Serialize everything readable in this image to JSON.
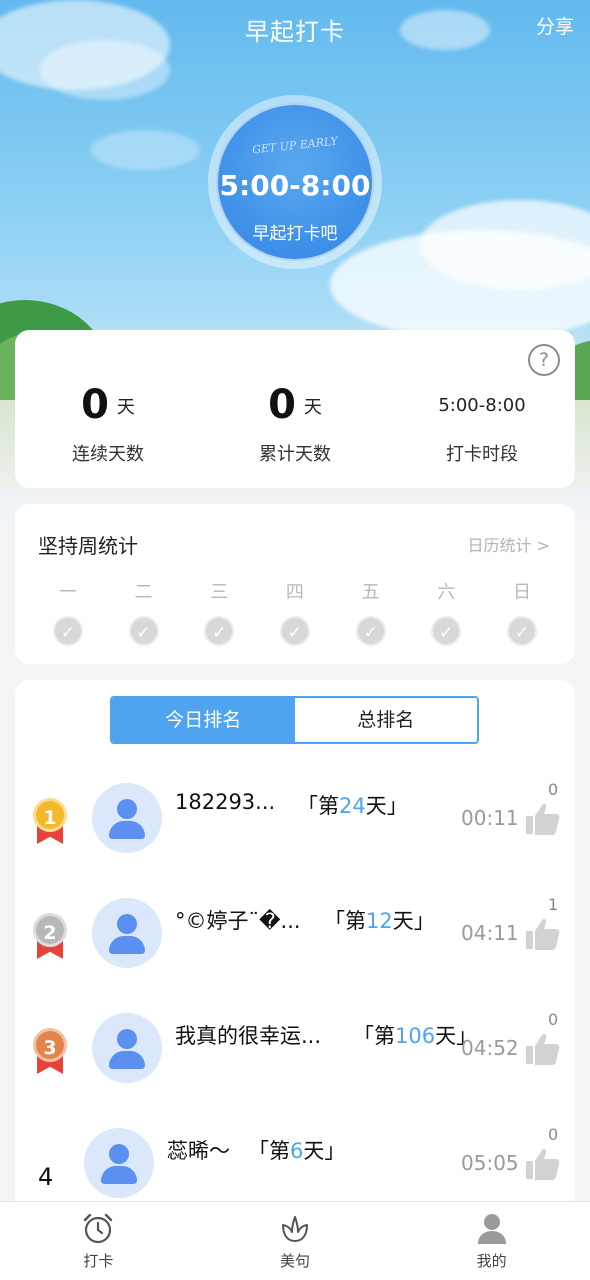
{
  "header": {
    "title": "早起打卡",
    "share_label": "分享"
  },
  "clock": {
    "badge_text": "GET UP EARLY",
    "time_range": "5:00-8:00",
    "subtitle": "早起打卡吧"
  },
  "stats": {
    "consecutive": {
      "value": "0",
      "unit": "天",
      "label": "连续天数"
    },
    "total": {
      "value": "0",
      "unit": "天",
      "label": "累计天数"
    },
    "period": {
      "value": "5:00-8:00",
      "label": "打卡时段"
    }
  },
  "week": {
    "title": "坚持周统计",
    "calendar_link": "日历统计 >",
    "days": [
      "一",
      "二",
      "三",
      "四",
      "五",
      "六",
      "日"
    ]
  },
  "ranking": {
    "tabs": [
      "今日排名",
      "总排名"
    ],
    "rows": [
      {
        "rank": "1",
        "name": "182293...",
        "streak_prefix": "「第",
        "streak_days": "24",
        "streak_suffix": "天」",
        "time": "00:11",
        "likes": "0"
      },
      {
        "rank": "2",
        "name": "°©婷子¨�...",
        "streak_prefix": "「第",
        "streak_days": "12",
        "streak_suffix": "天」",
        "time": "04:11",
        "likes": "1"
      },
      {
        "rank": "3",
        "name": "我真的很幸运...",
        "streak_prefix": "「第",
        "streak_days": "106",
        "streak_suffix": "天」",
        "time": "04:52",
        "likes": "0"
      },
      {
        "rank": "4",
        "name": "蕊晞～",
        "streak_prefix": "「第",
        "streak_days": "6",
        "streak_suffix": "天」",
        "time": "05:05",
        "likes": "0"
      }
    ]
  },
  "colors": {
    "accent": "#4ea4ef",
    "gold": "#f4b92b",
    "silver": "#b8b8b8",
    "bronze": "#e2854a"
  },
  "nav": [
    {
      "label": "打卡",
      "icon": "alarm-clock-icon"
    },
    {
      "label": "美句",
      "icon": "lotus-icon"
    },
    {
      "label": "我的",
      "icon": "user-icon"
    }
  ]
}
